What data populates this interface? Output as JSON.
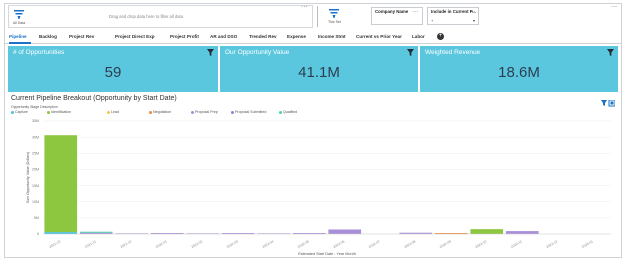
{
  "filter_bar": {
    "all_data_label": "All Data",
    "drop_hint": "Drag and drop data here to filter all data",
    "this_set_label": "This Set",
    "cards": [
      {
        "title": "Company Name",
        "value": ""
      },
      {
        "title": "Include in Current P...",
        "value": "+"
      }
    ],
    "menu_glyph": "···"
  },
  "tabs": [
    "Pipeline",
    "Backlog",
    "Project Rev",
    "Project Direct Exp",
    "Project Profit",
    "AR and DSO",
    "Trended Rev",
    "Expense",
    "Income Stmt",
    "Current vs Prior Year",
    "Labor"
  ],
  "active_tab": "Pipeline",
  "kpis": [
    {
      "title": "# of Opportunities",
      "value": "59"
    },
    {
      "title": "Our Opportunity Value",
      "value": "41.1M"
    },
    {
      "title": "Weighted Revenue",
      "value": "18.6M"
    }
  ],
  "colors": {
    "kpi_bg": "#5bc7de",
    "accent": "#1a73c8",
    "series": [
      "#4fc3e0",
      "#8dc63f",
      "#f2c94c",
      "#ef8c3a",
      "#a88fd8",
      "#9e7fd0",
      "#47d1b3"
    ]
  },
  "chart": {
    "title": "Current Pipeline Breakout (Opportunity by Start Date)",
    "legend_title": "Opportunity Stage Description",
    "xlabel": "Estimated Start Date - Year Month",
    "ylabel": "Sum Opportunity Value (Dollars)"
  },
  "chart_data": {
    "type": "bar",
    "stacked": true,
    "ylim": [
      0,
      35000000
    ],
    "y_ticks": [
      "0",
      "5M",
      "10M",
      "15M",
      "20M",
      "25M",
      "30M",
      "35M"
    ],
    "categories": [
      "2021-10",
      "2021-11",
      "2021-12",
      "2022-01",
      "2022-02",
      "2022-03",
      "2022-04",
      "2022-05",
      "2022-06",
      "2022-07",
      "2022-08",
      "2022-09",
      "2022-10",
      "2022-11",
      "2022-12",
      "2023-01"
    ],
    "series": [
      {
        "name": "Capture",
        "values": [
          600000,
          0,
          0,
          0,
          0,
          0,
          0,
          0,
          0,
          0,
          0,
          0,
          0,
          0,
          0,
          0
        ]
      },
      {
        "name": "Identification",
        "values": [
          30000000,
          0,
          0,
          0,
          0,
          0,
          0,
          0,
          0,
          0,
          0,
          0,
          1500000,
          0,
          0,
          0
        ]
      },
      {
        "name": "Lead",
        "values": [
          0,
          0,
          0,
          0,
          0,
          0,
          0,
          0,
          0,
          0,
          0,
          0,
          0,
          0,
          0,
          0
        ]
      },
      {
        "name": "Negotiation",
        "values": [
          0,
          0,
          0,
          0,
          0,
          0,
          0,
          0,
          0,
          0,
          0,
          300000,
          0,
          0,
          0,
          0
        ]
      },
      {
        "name": "Proposal Prep",
        "values": [
          0,
          400000,
          200000,
          300000,
          200000,
          300000,
          200000,
          300000,
          1400000,
          0,
          400000,
          0,
          0,
          900000,
          0,
          0
        ]
      },
      {
        "name": "Proposal Submitted",
        "values": [
          0,
          0,
          0,
          0,
          0,
          0,
          0,
          0,
          0,
          0,
          0,
          0,
          0,
          0,
          0,
          0
        ]
      },
      {
        "name": "Qualified",
        "values": [
          0,
          300000,
          0,
          0,
          0,
          0,
          0,
          0,
          0,
          0,
          0,
          0,
          0,
          0,
          0,
          0
        ]
      }
    ]
  }
}
